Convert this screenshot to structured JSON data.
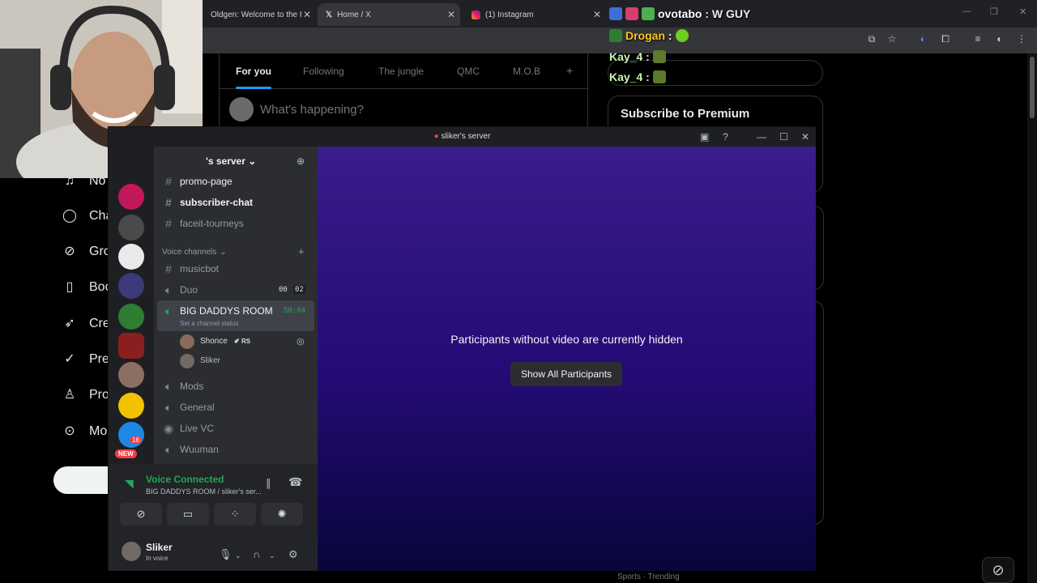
{
  "browser": {
    "tabs": [
      {
        "label": "Oldgen: Welcome to the I",
        "icon": "arrow-icon"
      },
      {
        "label": "Home / X",
        "icon": "x-logo-icon"
      },
      {
        "label": "(1) Instagram",
        "icon": "instagram-icon"
      }
    ]
  },
  "chat": [
    {
      "user": "ovotabo",
      "text": " : W GUY",
      "color": "#ffffff"
    },
    {
      "user": "Drogan",
      "text": " :",
      "color": "#f5c518"
    },
    {
      "user": "Kay_4",
      "text": " :",
      "color": "#c8f5b0"
    },
    {
      "user": "Kay_4",
      "text": " :",
      "color": "#c8f5b0"
    }
  ],
  "x": {
    "feed_tabs": [
      "For you",
      "Following",
      "The jungle",
      "QMC",
      "M.O.B"
    ],
    "composer_placeholder": "What's happening?",
    "premium_title": "Subscribe to Premium",
    "nav": [
      "No",
      "Cha",
      "Gro",
      "Boo",
      "Cre",
      "Pre",
      "Pro",
      "Mo"
    ],
    "sports_label": "Sports · Trending"
  },
  "discord": {
    "window_title": "sliker's server",
    "server_name": "'s server",
    "channels": {
      "text": [
        "promo-page",
        "subscriber-chat",
        "faceit-tourneys"
      ],
      "voice_header": "Voice channels",
      "musicbot": "musicbot",
      "duo": "Duo",
      "duo_timer_a": "00",
      "duo_timer_b": "02",
      "big_room": "BIG DADDYS ROOM",
      "big_room_timer": "58:04",
      "big_room_status": "Set a channel status",
      "members": [
        "Shonce",
        "Sliker"
      ],
      "member_tag": "RS",
      "others": [
        "Mods",
        "General",
        "Live VC",
        "Wuuman"
      ]
    },
    "guild_badge_count": "16",
    "guild_new_badge": "NEW",
    "stage": {
      "message": "Participants without video are currently hidden",
      "button": "Show All Participants"
    },
    "panel": {
      "status": "Voice Connected",
      "sub": "BIG DADDYS ROOM / sliker's ser...",
      "username": "Sliker",
      "user_status": "In voice"
    }
  }
}
